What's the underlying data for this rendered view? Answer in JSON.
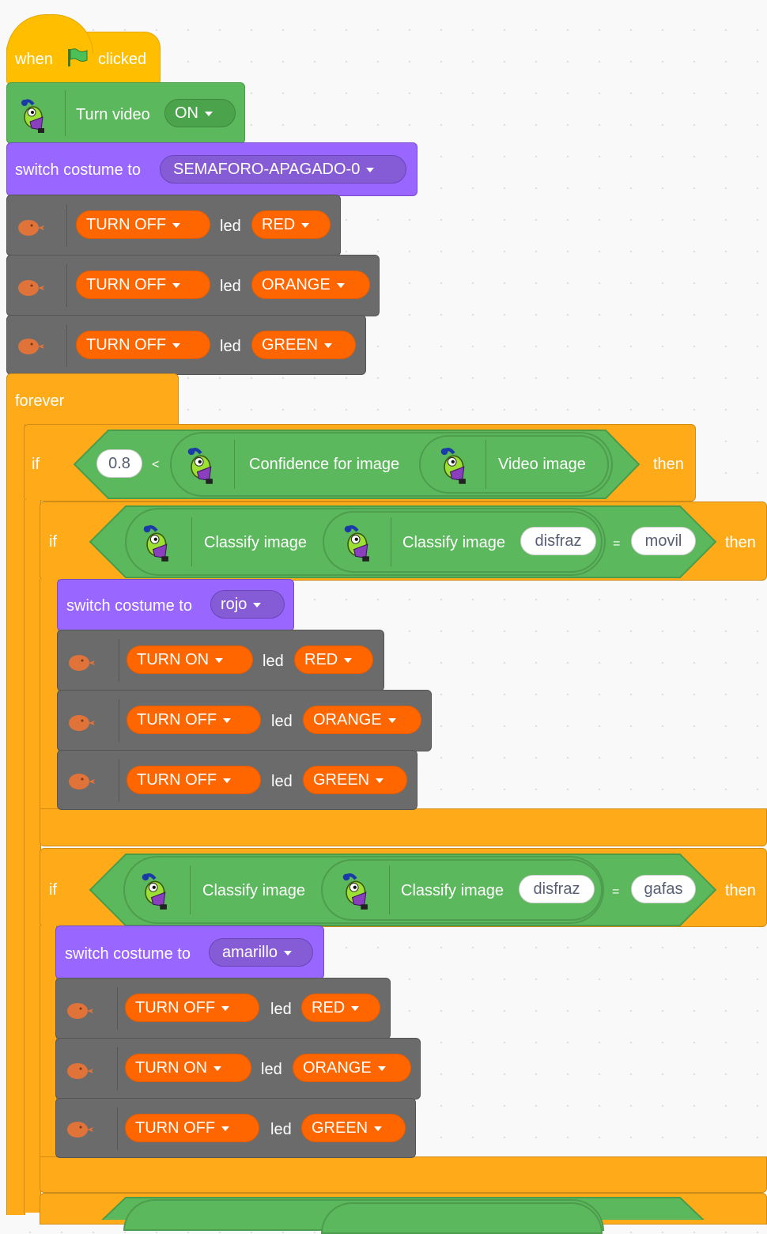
{
  "hat": {
    "when": "when",
    "clicked": "clicked"
  },
  "video": {
    "label": "Turn video",
    "value": "ON"
  },
  "costume_main": {
    "label": "switch costume to",
    "value": "SEMAFORO-APAGADO-0"
  },
  "led_label": "led",
  "init_leds": [
    {
      "action": "TURN  OFF",
      "color": "RED"
    },
    {
      "action": "TURN  OFF",
      "color": "ORANGE"
    },
    {
      "action": "TURN  OFF",
      "color": "GREEN"
    }
  ],
  "forever": "forever",
  "if_confidence": {
    "if": "if",
    "value": "0.8",
    "op": "<",
    "reporter": "Confidence for image",
    "inner": "Video image",
    "then": "then"
  },
  "if_movil": {
    "if": "if",
    "reporter": "Classify image",
    "inner": "Classify image",
    "arg": "disfraz",
    "op": "=",
    "compare": "movil",
    "then": "then",
    "costume": {
      "label": "switch costume to",
      "value": "rojo"
    },
    "leds": [
      {
        "action": "TURN  ON",
        "color": "RED"
      },
      {
        "action": "TURN  OFF",
        "color": "ORANGE"
      },
      {
        "action": "TURN  OFF",
        "color": "GREEN"
      }
    ]
  },
  "if_gafas": {
    "if": "if",
    "reporter": "Classify image",
    "inner": "Classify image",
    "arg": "disfraz",
    "op": "=",
    "compare": "gafas",
    "then": "then",
    "costume": {
      "label": "switch costume to",
      "value": "amarillo"
    },
    "leds": [
      {
        "action": "TURN  OFF",
        "color": "RED"
      },
      {
        "action": "TURN  ON",
        "color": "ORANGE"
      },
      {
        "action": "TURN  OFF",
        "color": "GREEN"
      }
    ]
  },
  "icons": {
    "sprite": "ml-sprite-icon",
    "arduino": "arduino-icon",
    "flag": "green-flag-icon"
  }
}
